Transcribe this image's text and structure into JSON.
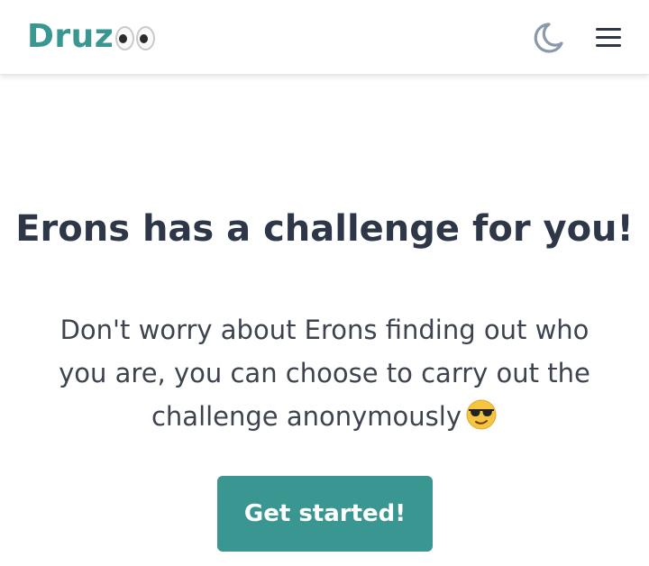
{
  "colors": {
    "brand": "#3a9690",
    "heading": "#2d3748",
    "body_text": "#3d4450",
    "icon": "#8a9aab",
    "menu_icon": "#2d3748"
  },
  "header": {
    "logo_text": "Druz",
    "logo_icon": "eyes-icon",
    "theme_toggle_icon": "moon-icon",
    "menu_icon": "hamburger-menu-icon"
  },
  "main": {
    "heading": "Erons has a challenge for you!",
    "description": "Don't worry about Erons finding out who you are, you can choose to carry out the challenge anonymously",
    "description_emoji": "sunglasses-emoji-icon",
    "cta_label": "Get started!"
  }
}
